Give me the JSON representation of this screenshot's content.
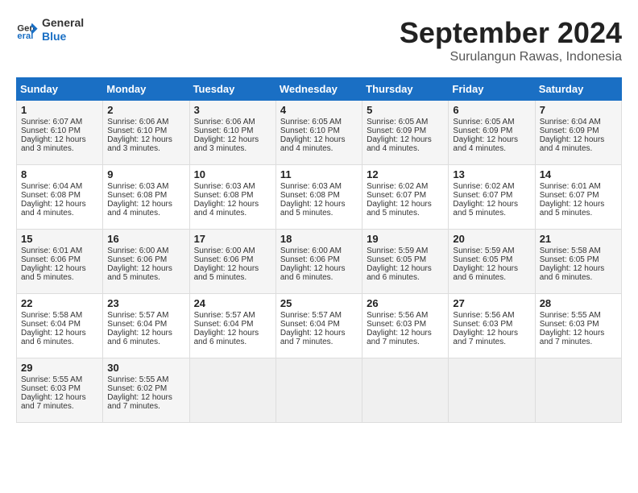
{
  "header": {
    "logo_line1": "General",
    "logo_line2": "Blue",
    "month_title": "September 2024",
    "location": "Surulangun Rawas, Indonesia"
  },
  "weekdays": [
    "Sunday",
    "Monday",
    "Tuesday",
    "Wednesday",
    "Thursday",
    "Friday",
    "Saturday"
  ],
  "weeks": [
    [
      {
        "day": "1",
        "sunrise": "Sunrise: 6:07 AM",
        "sunset": "Sunset: 6:10 PM",
        "daylight": "Daylight: 12 hours and 3 minutes."
      },
      {
        "day": "2",
        "sunrise": "Sunrise: 6:06 AM",
        "sunset": "Sunset: 6:10 PM",
        "daylight": "Daylight: 12 hours and 3 minutes."
      },
      {
        "day": "3",
        "sunrise": "Sunrise: 6:06 AM",
        "sunset": "Sunset: 6:10 PM",
        "daylight": "Daylight: 12 hours and 3 minutes."
      },
      {
        "day": "4",
        "sunrise": "Sunrise: 6:05 AM",
        "sunset": "Sunset: 6:10 PM",
        "daylight": "Daylight: 12 hours and 4 minutes."
      },
      {
        "day": "5",
        "sunrise": "Sunrise: 6:05 AM",
        "sunset": "Sunset: 6:09 PM",
        "daylight": "Daylight: 12 hours and 4 minutes."
      },
      {
        "day": "6",
        "sunrise": "Sunrise: 6:05 AM",
        "sunset": "Sunset: 6:09 PM",
        "daylight": "Daylight: 12 hours and 4 minutes."
      },
      {
        "day": "7",
        "sunrise": "Sunrise: 6:04 AM",
        "sunset": "Sunset: 6:09 PM",
        "daylight": "Daylight: 12 hours and 4 minutes."
      }
    ],
    [
      {
        "day": "8",
        "sunrise": "Sunrise: 6:04 AM",
        "sunset": "Sunset: 6:08 PM",
        "daylight": "Daylight: 12 hours and 4 minutes."
      },
      {
        "day": "9",
        "sunrise": "Sunrise: 6:03 AM",
        "sunset": "Sunset: 6:08 PM",
        "daylight": "Daylight: 12 hours and 4 minutes."
      },
      {
        "day": "10",
        "sunrise": "Sunrise: 6:03 AM",
        "sunset": "Sunset: 6:08 PM",
        "daylight": "Daylight: 12 hours and 4 minutes."
      },
      {
        "day": "11",
        "sunrise": "Sunrise: 6:03 AM",
        "sunset": "Sunset: 6:08 PM",
        "daylight": "Daylight: 12 hours and 5 minutes."
      },
      {
        "day": "12",
        "sunrise": "Sunrise: 6:02 AM",
        "sunset": "Sunset: 6:07 PM",
        "daylight": "Daylight: 12 hours and 5 minutes."
      },
      {
        "day": "13",
        "sunrise": "Sunrise: 6:02 AM",
        "sunset": "Sunset: 6:07 PM",
        "daylight": "Daylight: 12 hours and 5 minutes."
      },
      {
        "day": "14",
        "sunrise": "Sunrise: 6:01 AM",
        "sunset": "Sunset: 6:07 PM",
        "daylight": "Daylight: 12 hours and 5 minutes."
      }
    ],
    [
      {
        "day": "15",
        "sunrise": "Sunrise: 6:01 AM",
        "sunset": "Sunset: 6:06 PM",
        "daylight": "Daylight: 12 hours and 5 minutes."
      },
      {
        "day": "16",
        "sunrise": "Sunrise: 6:00 AM",
        "sunset": "Sunset: 6:06 PM",
        "daylight": "Daylight: 12 hours and 5 minutes."
      },
      {
        "day": "17",
        "sunrise": "Sunrise: 6:00 AM",
        "sunset": "Sunset: 6:06 PM",
        "daylight": "Daylight: 12 hours and 5 minutes."
      },
      {
        "day": "18",
        "sunrise": "Sunrise: 6:00 AM",
        "sunset": "Sunset: 6:06 PM",
        "daylight": "Daylight: 12 hours and 6 minutes."
      },
      {
        "day": "19",
        "sunrise": "Sunrise: 5:59 AM",
        "sunset": "Sunset: 6:05 PM",
        "daylight": "Daylight: 12 hours and 6 minutes."
      },
      {
        "day": "20",
        "sunrise": "Sunrise: 5:59 AM",
        "sunset": "Sunset: 6:05 PM",
        "daylight": "Daylight: 12 hours and 6 minutes."
      },
      {
        "day": "21",
        "sunrise": "Sunrise: 5:58 AM",
        "sunset": "Sunset: 6:05 PM",
        "daylight": "Daylight: 12 hours and 6 minutes."
      }
    ],
    [
      {
        "day": "22",
        "sunrise": "Sunrise: 5:58 AM",
        "sunset": "Sunset: 6:04 PM",
        "daylight": "Daylight: 12 hours and 6 minutes."
      },
      {
        "day": "23",
        "sunrise": "Sunrise: 5:57 AM",
        "sunset": "Sunset: 6:04 PM",
        "daylight": "Daylight: 12 hours and 6 minutes."
      },
      {
        "day": "24",
        "sunrise": "Sunrise: 5:57 AM",
        "sunset": "Sunset: 6:04 PM",
        "daylight": "Daylight: 12 hours and 6 minutes."
      },
      {
        "day": "25",
        "sunrise": "Sunrise: 5:57 AM",
        "sunset": "Sunset: 6:04 PM",
        "daylight": "Daylight: 12 hours and 7 minutes."
      },
      {
        "day": "26",
        "sunrise": "Sunrise: 5:56 AM",
        "sunset": "Sunset: 6:03 PM",
        "daylight": "Daylight: 12 hours and 7 minutes."
      },
      {
        "day": "27",
        "sunrise": "Sunrise: 5:56 AM",
        "sunset": "Sunset: 6:03 PM",
        "daylight": "Daylight: 12 hours and 7 minutes."
      },
      {
        "day": "28",
        "sunrise": "Sunrise: 5:55 AM",
        "sunset": "Sunset: 6:03 PM",
        "daylight": "Daylight: 12 hours and 7 minutes."
      }
    ],
    [
      {
        "day": "29",
        "sunrise": "Sunrise: 5:55 AM",
        "sunset": "Sunset: 6:03 PM",
        "daylight": "Daylight: 12 hours and 7 minutes."
      },
      {
        "day": "30",
        "sunrise": "Sunrise: 5:55 AM",
        "sunset": "Sunset: 6:02 PM",
        "daylight": "Daylight: 12 hours and 7 minutes."
      },
      null,
      null,
      null,
      null,
      null
    ]
  ]
}
